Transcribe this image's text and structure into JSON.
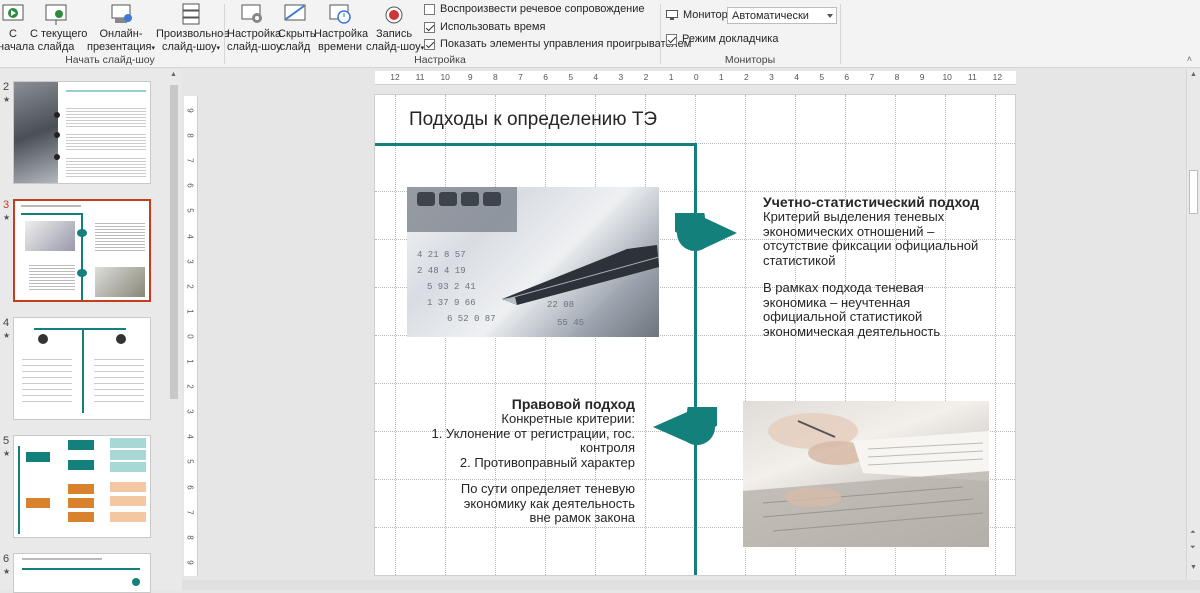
{
  "ribbon": {
    "start_from_beginning": "С\nначала",
    "start_from_current": "С текущего\nслайда",
    "online_presentation": "Онлайн-\nпрезентация",
    "custom_show": "Произвольное\nслайд-шоу",
    "group_start": "Начать слайд-шоу",
    "setup_show": "Настройка\nслайд-шоу",
    "hide_slide": "Скрыть\nслайд",
    "rehearse_timings": "Настройка\nвремени",
    "record": "Запись\nслайд-шоу",
    "play_narrations": "Воспроизвести речевое сопровождение",
    "use_timings": "Использовать время",
    "show_media_controls": "Показать элементы управления проигрывателем",
    "group_setup": "Настройка",
    "monitor_label": "Монитор:",
    "monitor_value": "Автоматически",
    "presenter_view": "Режим докладчика",
    "group_monitors": "Мониторы"
  },
  "checkboxes": {
    "play_narrations": false,
    "use_timings": true,
    "show_media_controls": true,
    "presenter_view": true
  },
  "thumbnails": [
    {
      "num": "2",
      "active": false
    },
    {
      "num": "3",
      "active": true
    },
    {
      "num": "4",
      "active": false
    },
    {
      "num": "5",
      "active": false
    },
    {
      "num": "6",
      "active": false
    }
  ],
  "rulers": {
    "h": [
      "12",
      "11",
      "10",
      "9",
      "8",
      "7",
      "6",
      "5",
      "4",
      "3",
      "2",
      "1",
      "0",
      "1",
      "2",
      "3",
      "4",
      "5",
      "6",
      "7",
      "8",
      "9",
      "10",
      "11",
      "12"
    ],
    "v": [
      "9",
      "8",
      "7",
      "6",
      "5",
      "4",
      "3",
      "2",
      "1",
      "0",
      "1",
      "2",
      "3",
      "4",
      "5",
      "6",
      "7",
      "8",
      "9"
    ]
  },
  "slide": {
    "title": "Подходы к определению ТЭ",
    "block1_heading": "Учетно-статистический подход",
    "block1_text1": "Критерий выделения теневых экономических отношений – отсутствие фиксации официальной статистикой",
    "block1_text2": "В рамках подхода теневая экономика – неучтенная официальной статистикой экономическая деятельность",
    "block2_heading": "Правовой подход",
    "block2_line1": "Конкретные критерии:",
    "block2_line2": "1. Уклонение от регистрации, гос. контроля",
    "block2_line3": "2. Противоправный характер",
    "block2_text2": "По сути определяет теневую экономику как деятельность вне рамок закона"
  },
  "colors": {
    "accent": "#14807c",
    "selection": "#c43e1c"
  }
}
